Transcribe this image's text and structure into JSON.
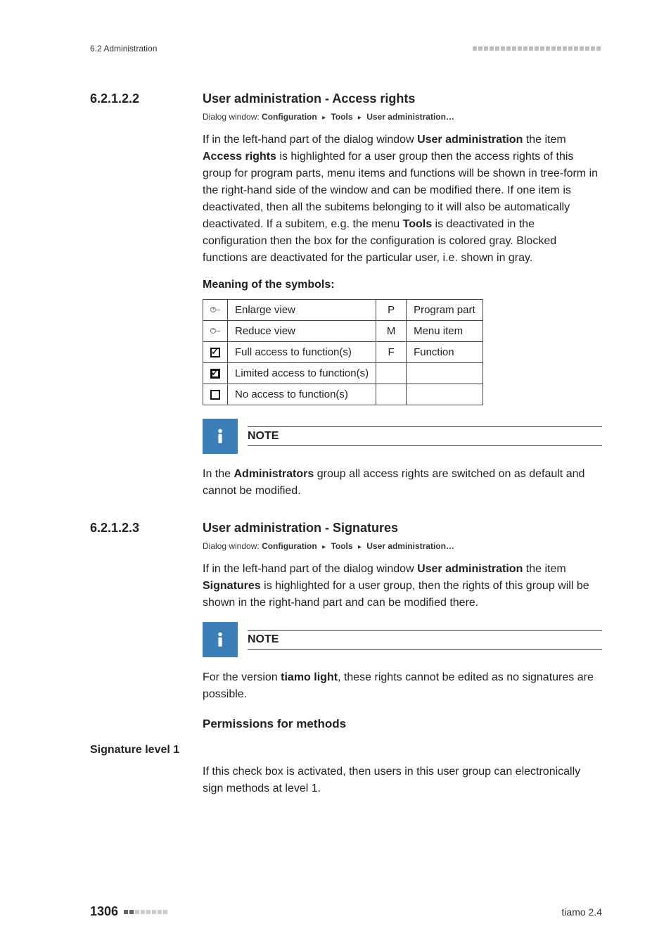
{
  "header": {
    "section_label": "6.2 Administration"
  },
  "sections": {
    "s1": {
      "number": "6.2.1.2.2",
      "title": "User administration - Access rights",
      "dialog_prefix": "Dialog window:",
      "breadcrumb": [
        "Configuration",
        "Tools",
        "User administration…"
      ],
      "paragraph_parts": {
        "p1a": "If in the left-hand part of the dialog window ",
        "p1b": "User administration",
        "p1c": " the item ",
        "p1d": "Access rights",
        "p1e": " is highlighted for a user group then the access rights of this group for program parts, menu items and functions will be shown in tree-form in the right-hand side of the window and can be modified there. If one item is deactivated, then all the subitems belonging to it will also be automatically deactivated. If a subitem, e.g. the menu ",
        "p1f": "Tools",
        "p1g": " is deactivated in the configuration then the box for the configuration is colored gray. Blocked functions are deactivated for the particular user, i.e. shown in gray."
      },
      "symbols_heading": "Meaning of the symbols:",
      "symbols": [
        {
          "label": "Enlarge view",
          "code": "P",
          "meaning": "Program part"
        },
        {
          "label": "Reduce view",
          "code": "M",
          "meaning": "Menu item"
        },
        {
          "label": "Full access to function(s)",
          "code": "F",
          "meaning": "Function"
        },
        {
          "label": "Limited access to function(s)",
          "code": "",
          "meaning": ""
        },
        {
          "label": "No access to function(s)",
          "code": "",
          "meaning": ""
        }
      ],
      "note_title": "NOTE",
      "note_body_a": "In the ",
      "note_body_b": "Administrators",
      "note_body_c": " group all access rights are switched on as default and cannot be modified."
    },
    "s2": {
      "number": "6.2.1.2.3",
      "title": "User administration - Signatures",
      "dialog_prefix": "Dialog window:",
      "breadcrumb": [
        "Configuration",
        "Tools",
        "User administration…"
      ],
      "paragraph_parts": {
        "p1a": "If in the left-hand part of the dialog window ",
        "p1b": "User administration",
        "p1c": " the item ",
        "p1d": "Signatures",
        "p1e": " is highlighted for a user group, then the rights of this group will be shown in the right-hand part and can be modified there."
      },
      "note_title": "NOTE",
      "note_body_a": "For the version ",
      "note_body_b": "tiamo light",
      "note_body_c": ", these rights cannot be edited as no signatures are possible.",
      "permissions_heading": "Permissions for methods",
      "sig_level_heading": "Signature level 1",
      "sig_level_text": "If this check box is activated, then users in this user group can electronically sign methods at level 1."
    }
  },
  "footer": {
    "page": "1306",
    "product": "tiamo 2.4"
  }
}
